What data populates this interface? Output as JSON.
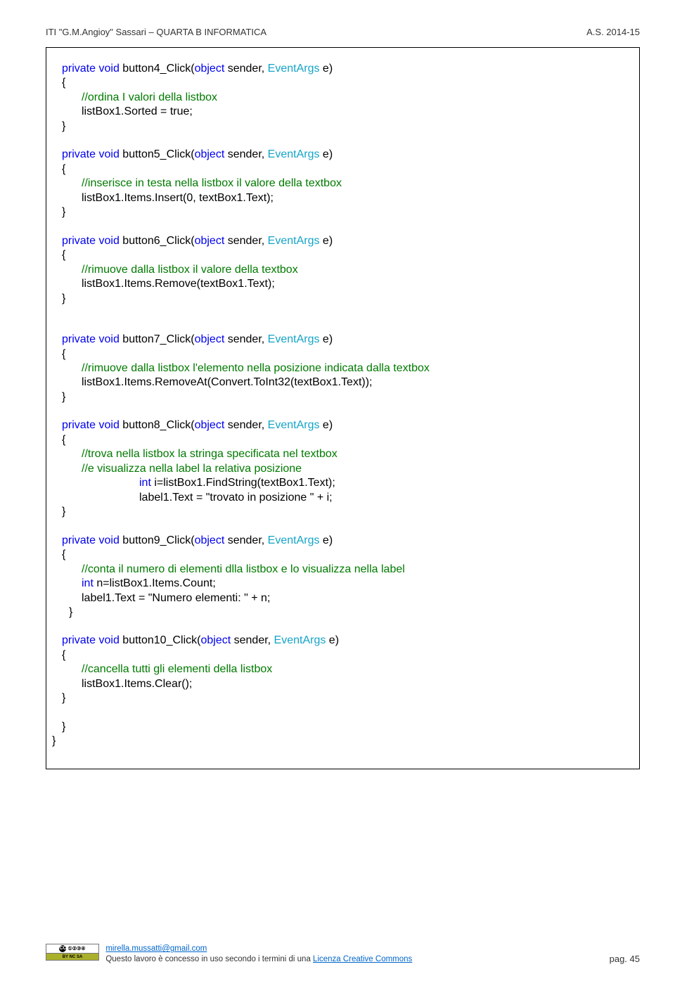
{
  "header": {
    "left": "ITI \"G.M.Angioy\" Sassari – QUARTA B   INFORMATICA",
    "right": "A.S. 2014-15"
  },
  "kw": {
    "private": "private",
    "void": "void",
    "object": "object",
    "int": "int"
  },
  "typ": {
    "EventArgs": "EventArgs"
  },
  "fn": {
    "b4": "button4_Click(",
    "b5": "button5_Click(",
    "b6": "button6_Click(",
    "b7": "button7_Click(",
    "b8": "button8_Click(",
    "b9": "button9_Click(",
    "b10": "button10_Click("
  },
  "sig_tail": " sender, ",
  "sig_end": " e)",
  "brace_open": "{",
  "brace_close": "}",
  "cmt": {
    "c4": "//ordina I valori della listbox",
    "c5": "//inserisce in testa nella listbox il valore della textbox",
    "c6": "//rimuove  dalla listbox il valore della textbox",
    "c7": "//rimuove dalla listbox l'elemento nella posizione indicata dalla textbox",
    "c8a": "//trova nella listbox la stringa specificata nel textbox",
    "c8b": "//e visualizza nella label la relativa posizione",
    "c9": "//conta il numero di elementi dlla listbox  e lo visualizza nella label",
    "c10": "//cancella tutti gli elementi della listbox"
  },
  "body": {
    "l4": "listBox1.Sorted = true;",
    "l5": "listBox1.Items.Insert(0, textBox1.Text);",
    "l6": "listBox1.Items.Remove(textBox1.Text);",
    "l7": "listBox1.Items.RemoveAt(Convert.ToInt32(textBox1.Text));",
    "l8a_pre": " i=listBox1.FindString(textBox1.Text);",
    "l8b": "label1.Text = \"trovato in posizione \" + i;",
    "l9a_pre": " n=listBox1.Items.Count;",
    "l9b": "label1.Text = \"Numero elementi: \" + n;",
    "l10": "listBox1.Items.Clear();"
  },
  "footer": {
    "email": "mirella.mussatti@gmail.com",
    "line2a": "Questo lavoro è concesso in uso secondo i termini di una  ",
    "line2b": "Licenza Creative Commons",
    "page_label": "pag.  ",
    "page_num": "45"
  }
}
